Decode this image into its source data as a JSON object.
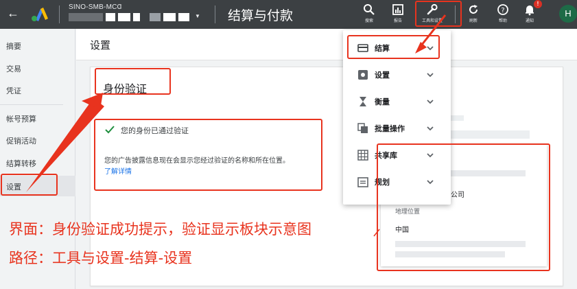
{
  "topbar": {
    "account_name": "SINO-SMB-MCC",
    "page_title": "结算与付款",
    "tools": [
      {
        "label": "搜索",
        "icon": "search-icon"
      },
      {
        "label": "报告",
        "icon": "reports-icon"
      },
      {
        "label": "工具和设置",
        "icon": "wrench-icon"
      },
      {
        "label": "刷新",
        "icon": "refresh-icon"
      },
      {
        "label": "帮助",
        "icon": "help-icon"
      },
      {
        "label": "通知",
        "icon": "bell-icon"
      }
    ],
    "notification_count": "!",
    "avatar_letter": "H"
  },
  "sidebar": {
    "items": [
      {
        "label": "摘要"
      },
      {
        "label": "交易"
      },
      {
        "label": "凭证"
      },
      {
        "label": "帐号预算"
      },
      {
        "label": "促销活动"
      },
      {
        "label": "结算转移"
      },
      {
        "label": "设置"
      }
    ]
  },
  "main": {
    "header_title": "设置",
    "card_title": "身份验证",
    "verified_text": "您的身份已通过验证",
    "description": "您的广告披露信息现在会显示您经过验证的名称和所在位置。",
    "learn_more": "了解详情",
    "company_partial": "科技有限公司",
    "geo_label": "地理位置",
    "geo_value": "中国"
  },
  "menu": {
    "items": [
      {
        "label": "结算",
        "icon": "credit-card-icon"
      },
      {
        "label": "设置",
        "icon": "gear-icon"
      },
      {
        "label": "衡量",
        "icon": "hourglass-icon"
      },
      {
        "label": "批量操作",
        "icon": "copy-icon"
      },
      {
        "label": "共享库",
        "icon": "grid-icon"
      },
      {
        "label": "规划",
        "icon": "calendar-icon"
      }
    ]
  },
  "annotations": {
    "line1": "界面：身份验证成功提示，验证显示板块示意图",
    "line2": "路径：工具与设置-结算-设置"
  },
  "colors": {
    "topbar": "#3c4043",
    "annotation_red": "#e8331e",
    "link_blue": "#1a73e8",
    "check_green": "#1e8e3e"
  }
}
